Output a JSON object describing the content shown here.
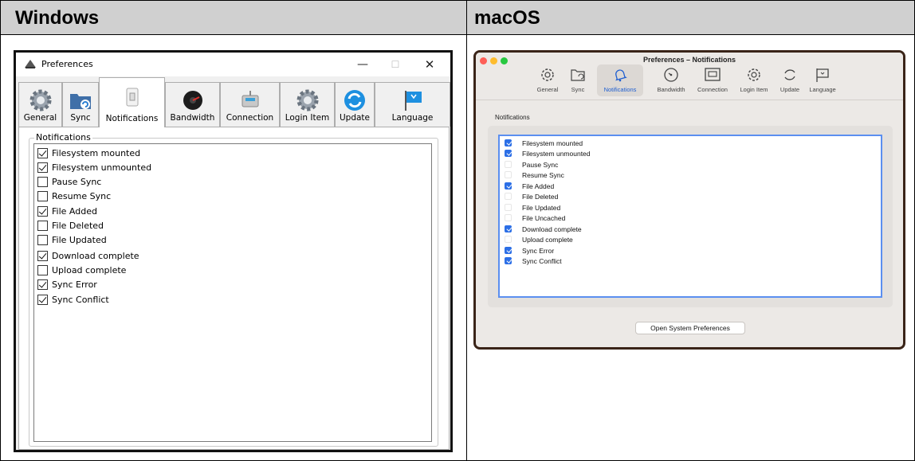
{
  "headers": {
    "windows": "Windows",
    "macos": "macOS"
  },
  "windows": {
    "title": "Preferences",
    "controls": {
      "minimize": "—",
      "maximize": "☐",
      "close": "✕"
    },
    "tabs": [
      {
        "label": "General",
        "icon": "gear-icon",
        "active": false
      },
      {
        "label": "Sync",
        "icon": "sync-folder-icon",
        "active": false
      },
      {
        "label": "Notifications",
        "icon": "notifications-switch-icon",
        "active": true
      },
      {
        "label": "Bandwidth",
        "icon": "bandwidth-dial-icon",
        "active": false
      },
      {
        "label": "Connection",
        "icon": "connection-icon",
        "active": false
      },
      {
        "label": "Login Item",
        "icon": "gear-icon",
        "active": false
      },
      {
        "label": "Update",
        "icon": "update-icon",
        "active": false
      },
      {
        "label": "Language",
        "icon": "language-flag-icon",
        "active": false
      }
    ],
    "group_label": "Notifications",
    "items": [
      {
        "label": "Filesystem mounted",
        "checked": true
      },
      {
        "label": "Filesystem unmounted",
        "checked": true
      },
      {
        "label": "Pause Sync",
        "checked": false
      },
      {
        "label": "Resume Sync",
        "checked": false
      },
      {
        "label": "File Added",
        "checked": true
      },
      {
        "label": "File Deleted",
        "checked": false
      },
      {
        "label": "File Updated",
        "checked": false
      },
      {
        "label": "Download complete",
        "checked": true
      },
      {
        "label": "Upload complete",
        "checked": false
      },
      {
        "label": "Sync Error",
        "checked": true
      },
      {
        "label": "Sync Conflict",
        "checked": true
      }
    ]
  },
  "macos": {
    "title": "Preferences – Notifications",
    "tabs": [
      {
        "label": "General",
        "icon": "gear-icon",
        "active": false
      },
      {
        "label": "Sync",
        "icon": "folder-sync-icon",
        "active": false
      },
      {
        "label": "Notifications",
        "icon": "bell-icon",
        "active": true
      },
      {
        "label": "Bandwidth",
        "icon": "gauge-icon",
        "active": false
      },
      {
        "label": "Connection",
        "icon": "network-port-icon",
        "active": false
      },
      {
        "label": "Login Item",
        "icon": "gear-icon",
        "active": false
      },
      {
        "label": "Update",
        "icon": "refresh-icon",
        "active": false
      },
      {
        "label": "Language",
        "icon": "flag-icon",
        "active": false
      }
    ],
    "section_label": "Notifications",
    "items": [
      {
        "label": "Filesystem mounted",
        "checked": true
      },
      {
        "label": "Filesystem unmounted",
        "checked": true
      },
      {
        "label": "Pause Sync",
        "checked": false
      },
      {
        "label": "Resume Sync",
        "checked": false
      },
      {
        "label": "File Added",
        "checked": true
      },
      {
        "label": "File Deleted",
        "checked": false
      },
      {
        "label": "File Updated",
        "checked": false
      },
      {
        "label": "File Uncached",
        "checked": false
      },
      {
        "label": "Download complete",
        "checked": true
      },
      {
        "label": "Upload complete",
        "checked": false
      },
      {
        "label": "Sync Error",
        "checked": true
      },
      {
        "label": "Sync Conflict",
        "checked": true
      }
    ],
    "button_label": "Open System Preferences"
  }
}
